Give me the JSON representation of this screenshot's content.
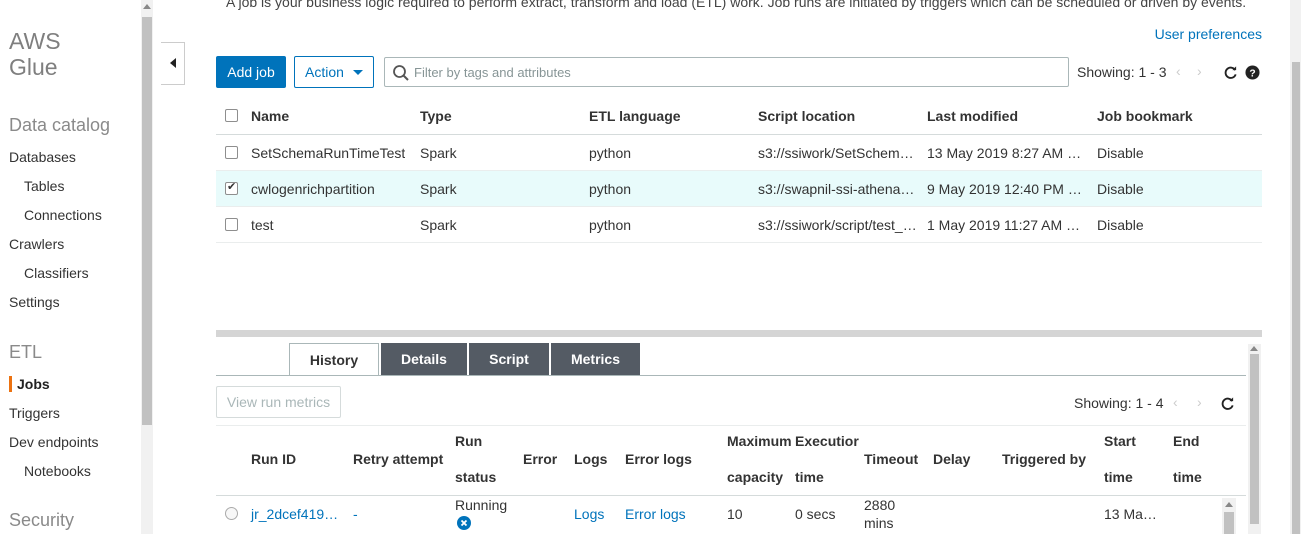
{
  "sidebar": {
    "brand": "AWS Glue",
    "data_catalog": {
      "title": "Data catalog",
      "items": [
        "Databases",
        "Tables",
        "Connections",
        "Crawlers",
        "Classifiers",
        "Settings"
      ]
    },
    "etl": {
      "title": "ETL",
      "items": [
        "Jobs",
        "Triggers",
        "Dev endpoints",
        "Notebooks"
      ],
      "active": "Jobs"
    },
    "security": {
      "title": "Security"
    }
  },
  "header": {
    "intro": "A job is your business logic required to perform extract, transform and load (ETL) work. Job runs are initiated by triggers which can be scheduled or driven by events.",
    "user_preferences": "User preferences"
  },
  "toolbar": {
    "add_job": "Add job",
    "action": "Action",
    "search_placeholder": "Filter by tags and attributes",
    "showing": "Showing: 1 - 3"
  },
  "jobs_table": {
    "columns": [
      "Name",
      "Type",
      "ETL language",
      "Script location",
      "Last modified",
      "Job bookmark"
    ],
    "rows": [
      {
        "name": "SetSchemaRunTimeTest",
        "type": "Spark",
        "language": "python",
        "script": "s3://ssiwork/SetSchem…",
        "modified": "13 May 2019 8:27 AM …",
        "bookmark": "Disable",
        "selected": false
      },
      {
        "name": "cwlogenrichpartition",
        "type": "Spark",
        "language": "python",
        "script": "s3://swapnil-ssi-athena…",
        "modified": "9 May 2019 12:40 PM …",
        "bookmark": "Disable",
        "selected": true
      },
      {
        "name": "test",
        "type": "Spark",
        "language": "python",
        "script": "s3://ssiwork/script/test_…",
        "modified": "1 May 2019 11:27 AM …",
        "bookmark": "Disable",
        "selected": false
      }
    ]
  },
  "tabs": [
    "History",
    "Details",
    "Script",
    "Metrics"
  ],
  "history": {
    "view_metrics": "View run metrics",
    "showing": "Showing: 1 - 4",
    "columns": {
      "run_id": "Run ID",
      "retry": "Retry attempt",
      "run_status_1": "Run",
      "run_status_2": "status",
      "error": "Error",
      "logs": "Logs",
      "error_logs": "Error logs",
      "max_cap_1": "Maximum",
      "max_cap_2": "capacity",
      "exec_1": "Executior",
      "exec_2": "time",
      "timeout": "Timeout",
      "delay": "Delay",
      "triggered_by": "Triggered by",
      "start_1": "Start",
      "start_2": "time",
      "end_1": "End",
      "end_2": "time"
    },
    "row": {
      "run_id": "jr_2dcef419…",
      "retry": "-",
      "status": "Running",
      "logs": "Logs",
      "error_logs": "Error logs",
      "max_capacity": "10",
      "exec_time": "0 secs",
      "timeout_1": "2880",
      "timeout_2": "mins",
      "start_time": "13 Ma…"
    }
  }
}
